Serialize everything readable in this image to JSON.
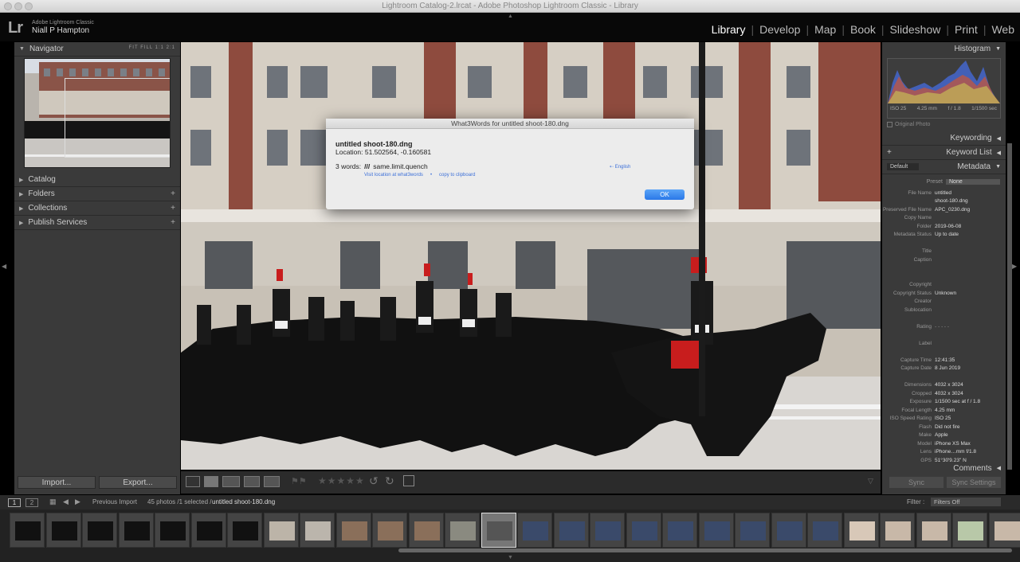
{
  "window": {
    "title": "Lightroom Catalog-2.lrcat - Adobe Photoshop Lightroom Classic - Library"
  },
  "header": {
    "logo": "Lr",
    "app_name": "Adobe Lightroom Classic",
    "user": "Niall P Hampton",
    "modules": [
      "Library",
      "Develop",
      "Map",
      "Book",
      "Slideshow",
      "Print",
      "Web"
    ],
    "selected_module": "Library"
  },
  "left": {
    "navigator": {
      "title": "Navigator",
      "options": "FIT  FILL  1:1  2:1"
    },
    "panels": [
      {
        "label": "Catalog",
        "plus": ""
      },
      {
        "label": "Folders",
        "plus": "+"
      },
      {
        "label": "Collections",
        "plus": "+"
      },
      {
        "label": "Publish Services",
        "plus": "+"
      }
    ],
    "import_label": "Import...",
    "export_label": "Export..."
  },
  "right": {
    "histogram": {
      "title": "Histogram",
      "iso": "ISO 25",
      "focal": "4.25 mm",
      "aperture": "f / 1.8",
      "shutter": "1/1500 sec",
      "original_photo": "Original Photo"
    },
    "keywording": "Keywording",
    "keyword_list": "Keyword List",
    "metadata": "Metadata",
    "metadata_preset_select": "Default",
    "preset_label": "Preset",
    "preset_value": "None",
    "fields": [
      {
        "k": "File Name",
        "v": "untitled"
      },
      {
        "k": "",
        "v": "shoot-180.dng"
      },
      {
        "k": "Preserved File Name",
        "v": "APC_0230.dng"
      },
      {
        "k": "Copy Name",
        "v": ""
      },
      {
        "k": "Folder",
        "v": "2019-06-08"
      },
      {
        "k": "Metadata Status",
        "v": "Up to date"
      },
      {
        "k": "",
        "v": ""
      },
      {
        "k": "Title",
        "v": ""
      },
      {
        "k": "Caption",
        "v": ""
      },
      {
        "k": "",
        "v": ""
      },
      {
        "k": "",
        "v": ""
      },
      {
        "k": "Copyright",
        "v": ""
      },
      {
        "k": "Copyright Status",
        "v": "Unknown"
      },
      {
        "k": "Creator",
        "v": ""
      },
      {
        "k": "Sublocation",
        "v": ""
      },
      {
        "k": "",
        "v": ""
      },
      {
        "k": "Rating",
        "v": "·  ·  ·  ·  ·"
      },
      {
        "k": "",
        "v": ""
      },
      {
        "k": "Label",
        "v": ""
      },
      {
        "k": "",
        "v": ""
      },
      {
        "k": "Capture Time",
        "v": "12:41:35"
      },
      {
        "k": "Capture Date",
        "v": "8 Jun 2019"
      },
      {
        "k": "",
        "v": ""
      },
      {
        "k": "Dimensions",
        "v": "4032 x 3024"
      },
      {
        "k": "Cropped",
        "v": "4032 x 3024"
      },
      {
        "k": "Exposure",
        "v": "1/1500 sec at f / 1.8"
      },
      {
        "k": "Focal Length",
        "v": "4.25 mm"
      },
      {
        "k": "ISO Speed Rating",
        "v": "ISO 25"
      },
      {
        "k": "Flash",
        "v": "Did not fire"
      },
      {
        "k": "Make",
        "v": "Apple"
      },
      {
        "k": "Model",
        "v": "iPhone XS Max"
      },
      {
        "k": "Lens",
        "v": "iPhone…mm f/1.8"
      },
      {
        "k": "GPS",
        "v": "51°30'9.23\" N"
      },
      {
        "k": "",
        "v": "0°9'38.091\" W"
      }
    ],
    "comments": "Comments",
    "sync_label": "Sync",
    "sync_settings_label": "Sync Settings"
  },
  "filmstrip_bar": {
    "view1": "1",
    "view2": "2",
    "source": "Previous Import",
    "count": "45 photos /1 selected /",
    "filename": "untitled shoot-180.dng",
    "filter_label": "Filter :",
    "filter_value": "Filters Off"
  },
  "dialog": {
    "title": "What3Words for untitled shoot-180.dng",
    "filename": "untitled shoot-180.dng",
    "location": "Location: 51.502564, -0.160581",
    "words_label": "3 words:",
    "slashes": "///",
    "words": "same.limit.quench",
    "language": "⇠ English",
    "visit_link": "Visit location at what3words",
    "bullet": "•",
    "copy_link": "copy to clipboard",
    "ok": "OK"
  },
  "colors": {
    "accent_blue": "#2a78e8",
    "panel_bg": "#3a3a3a",
    "dark_bg": "#080808"
  }
}
